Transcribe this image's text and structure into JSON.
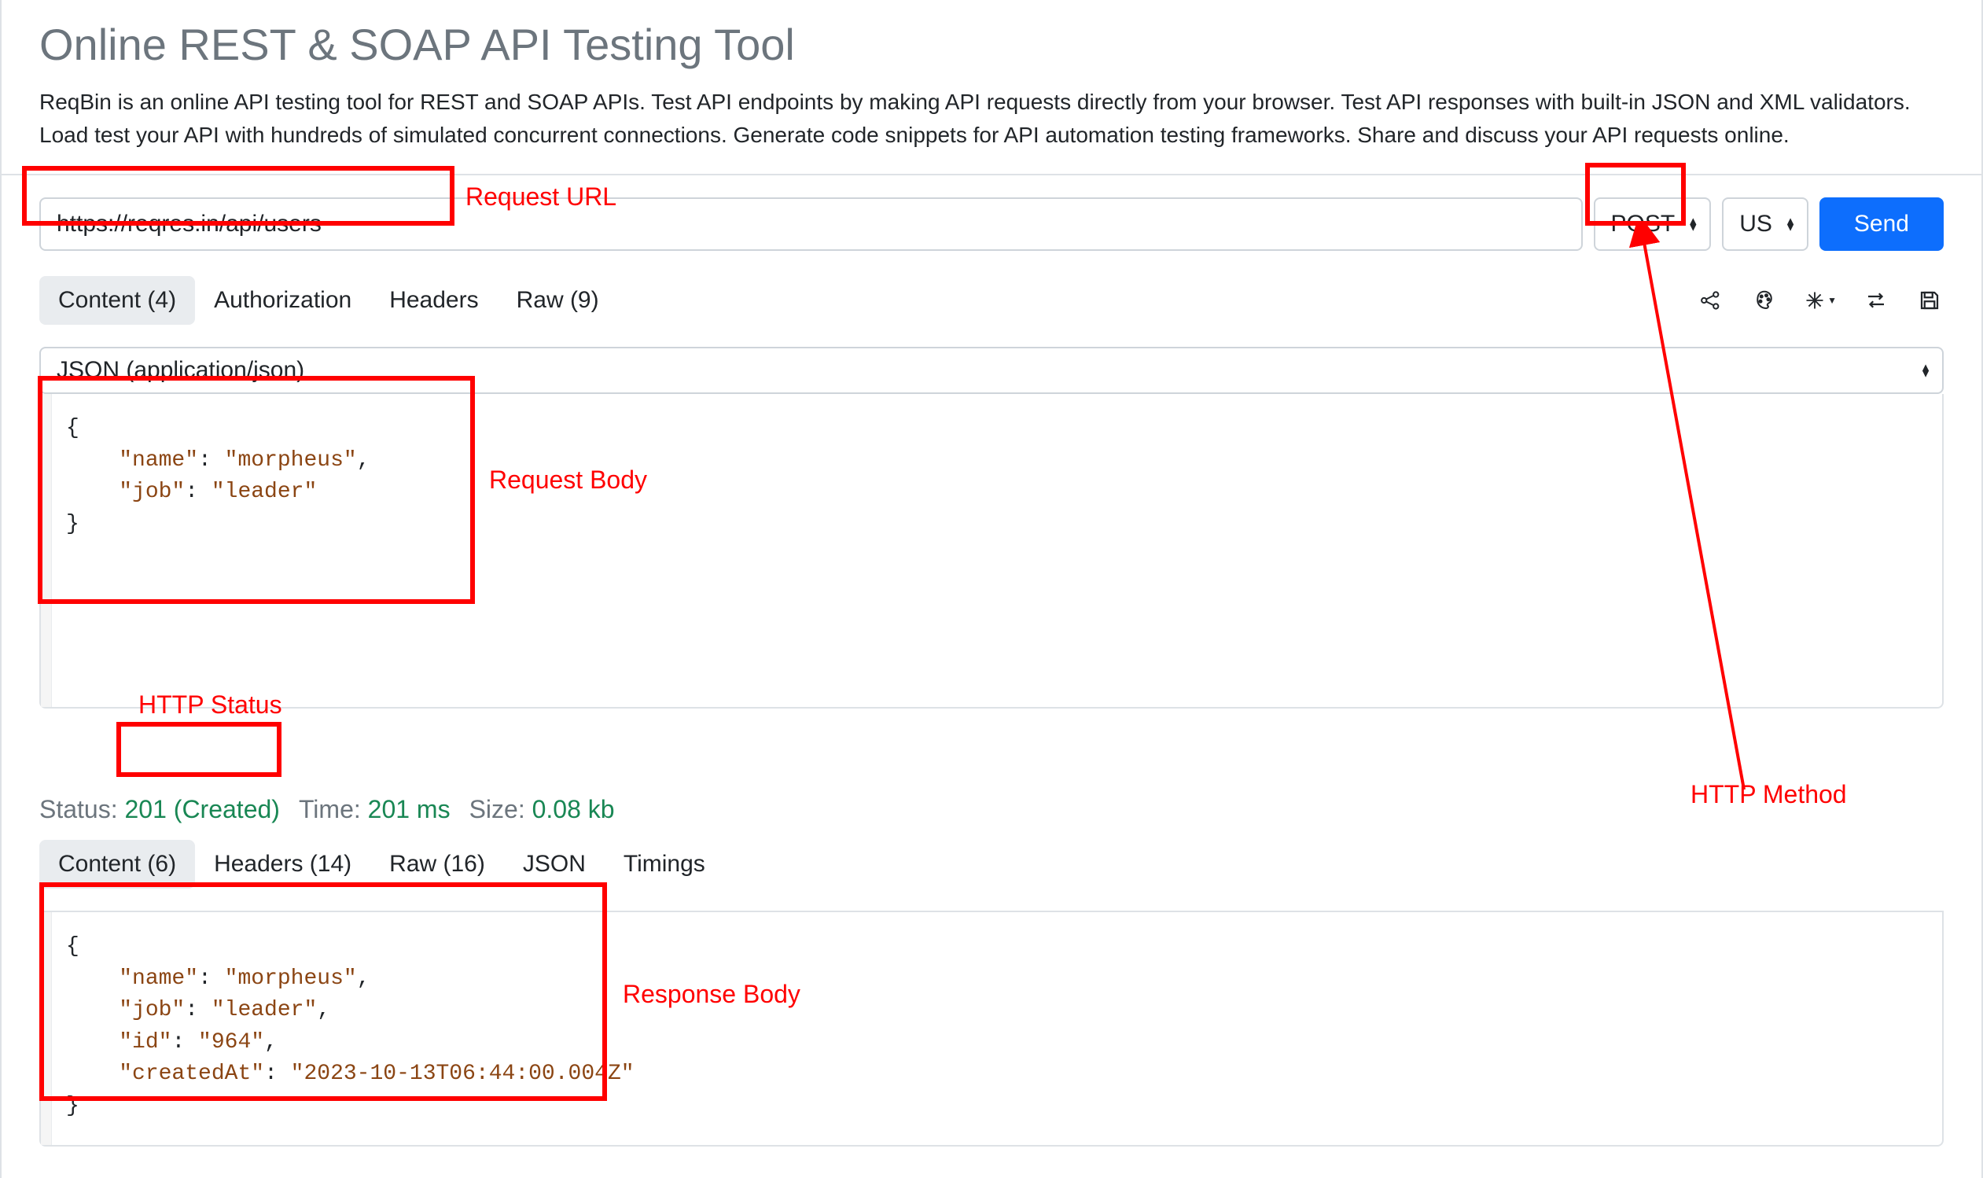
{
  "title": "Online REST & SOAP API Testing Tool",
  "intro": "ReqBin is an online API testing tool for REST and SOAP APIs. Test API endpoints by making API requests directly from your browser. Test API responses with built-in JSON and XML validators. Load test your API with hundreds of simulated concurrent connections. Generate code snippets for API automation testing frameworks. Share and discuss your API requests online.",
  "request": {
    "url": "https://reqres.in/api/users",
    "method": "POST",
    "region": "US",
    "send_label": "Send"
  },
  "req_tabs": {
    "content": "Content (4)",
    "auth": "Authorization",
    "headers": "Headers",
    "raw": "Raw (9)"
  },
  "content_type": "JSON (application/json)",
  "request_body": {
    "line1_open": "{",
    "line2_key": "\"name\"",
    "line2_val": "\"morpheus\"",
    "line3_key": "\"job\"",
    "line3_val": "\"leader\"",
    "line4_close": "}"
  },
  "response": {
    "status_label": "Status:",
    "status_value": "201 (Created)",
    "time_label": "Time:",
    "time_value": "201 ms",
    "size_label": "Size:",
    "size_value": "0.08 kb"
  },
  "resp_tabs": {
    "content": "Content (6)",
    "headers": "Headers (14)",
    "raw": "Raw (16)",
    "json": "JSON",
    "timings": "Timings"
  },
  "response_body": {
    "l1": "{",
    "l2k": "\"name\"",
    "l2v": "\"morpheus\"",
    "l3k": "\"job\"",
    "l3v": "\"leader\"",
    "l4k": "\"id\"",
    "l4v": "\"964\"",
    "l5k": "\"createdAt\"",
    "l5v": "\"2023-10-13T06:44:00.004Z\"",
    "l6": "}"
  },
  "annotations": {
    "request_url": "Request URL",
    "request_body": "Request Body",
    "http_status": "HTTP Status",
    "response_body": "Response Body",
    "http_method": "HTTP Method"
  }
}
